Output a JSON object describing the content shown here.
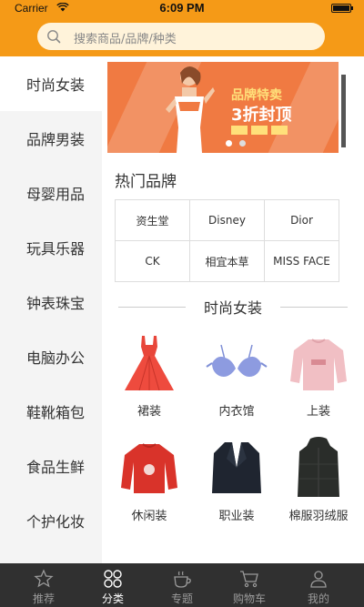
{
  "status": {
    "carrier": "Carrier",
    "time": "6:09 PM"
  },
  "search": {
    "placeholder": "搜索商品/品牌/种类"
  },
  "sidebar": {
    "items": [
      {
        "label": "时尚女装",
        "active": true
      },
      {
        "label": "品牌男装"
      },
      {
        "label": "母婴用品"
      },
      {
        "label": "玩具乐器"
      },
      {
        "label": "钟表珠宝"
      },
      {
        "label": "电脑办公"
      },
      {
        "label": "鞋靴箱包"
      },
      {
        "label": "食品生鲜"
      },
      {
        "label": "个护化妆"
      }
    ]
  },
  "banner": {
    "title": "品牌特卖",
    "subtitle": "3折封顶"
  },
  "hot_brands": {
    "title": "热门品牌",
    "items": [
      "资生堂",
      "Disney",
      "Dior",
      "CK",
      "相宜本草",
      "MISS FACE"
    ]
  },
  "category": {
    "title": "时尚女装",
    "products": [
      {
        "label": "裙装",
        "icon": "dress-icon"
      },
      {
        "label": "内衣馆",
        "icon": "bra-icon"
      },
      {
        "label": "上装",
        "icon": "sweatshirt-icon"
      },
      {
        "label": "休闲装",
        "icon": "sweater-icon"
      },
      {
        "label": "职业装",
        "icon": "blazer-icon"
      },
      {
        "label": "棉服羽绒服",
        "icon": "down-coat-icon"
      }
    ]
  },
  "tabbar": {
    "items": [
      {
        "label": "推荐",
        "icon": "star-icon"
      },
      {
        "label": "分类",
        "icon": "category-icon",
        "active": true
      },
      {
        "label": "专题",
        "icon": "cup-icon"
      },
      {
        "label": "购物车",
        "icon": "cart-icon"
      },
      {
        "label": "我的",
        "icon": "person-icon"
      }
    ]
  },
  "colors": {
    "accent": "#f59a17",
    "search_bg": "#fff3da",
    "tabbar": "#303030",
    "sidebar": "#f4f4f4"
  }
}
